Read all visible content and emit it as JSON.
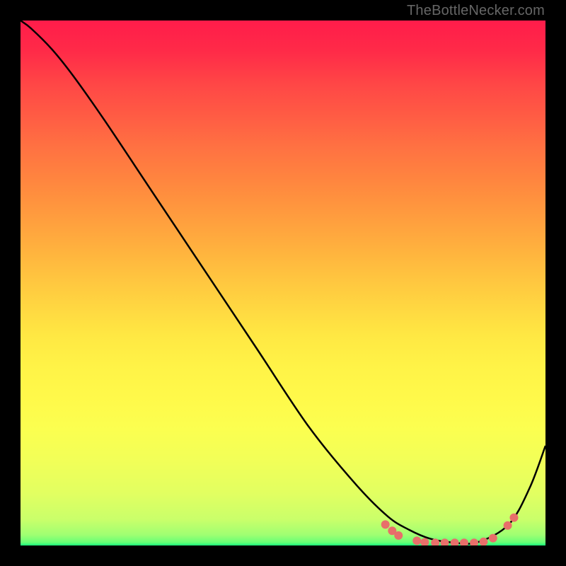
{
  "attribution": "TheBottleNecker.com",
  "chart_data": {
    "type": "line",
    "title": "",
    "xlabel": "",
    "ylabel": "",
    "xlim": [
      0,
      1
    ],
    "ylim": [
      0,
      1
    ],
    "legend": false,
    "grid": false,
    "series": [
      {
        "name": "curve",
        "x": [
          0.0,
          0.02,
          0.06,
          0.1,
          0.16,
          0.25,
          0.35,
          0.45,
          0.55,
          0.64,
          0.7,
          0.74,
          0.78,
          0.82,
          0.87,
          0.93,
          0.97,
          1.0
        ],
        "y": [
          1.0,
          0.985,
          0.945,
          0.895,
          0.81,
          0.675,
          0.525,
          0.375,
          0.225,
          0.115,
          0.055,
          0.03,
          0.013,
          0.006,
          0.006,
          0.04,
          0.11,
          0.19
        ],
        "color": "#000000",
        "width": 2.5
      }
    ],
    "markers": {
      "name": "dots",
      "points": [
        {
          "x": 0.695,
          "y": 0.04
        },
        {
          "x": 0.708,
          "y": 0.028
        },
        {
          "x": 0.72,
          "y": 0.019
        },
        {
          "x": 0.755,
          "y": 0.009
        },
        {
          "x": 0.77,
          "y": 0.006
        },
        {
          "x": 0.79,
          "y": 0.005
        },
        {
          "x": 0.808,
          "y": 0.005
        },
        {
          "x": 0.827,
          "y": 0.005
        },
        {
          "x": 0.845,
          "y": 0.005
        },
        {
          "x": 0.864,
          "y": 0.005
        },
        {
          "x": 0.882,
          "y": 0.007
        },
        {
          "x": 0.9,
          "y": 0.014
        },
        {
          "x": 0.928,
          "y": 0.038
        },
        {
          "x": 0.94,
          "y": 0.053
        }
      ],
      "color": "#e86f6a",
      "radius": 6
    },
    "background_gradient": {
      "top_color": "#ff1c4a",
      "bottom_color": "#1aff7c"
    }
  }
}
